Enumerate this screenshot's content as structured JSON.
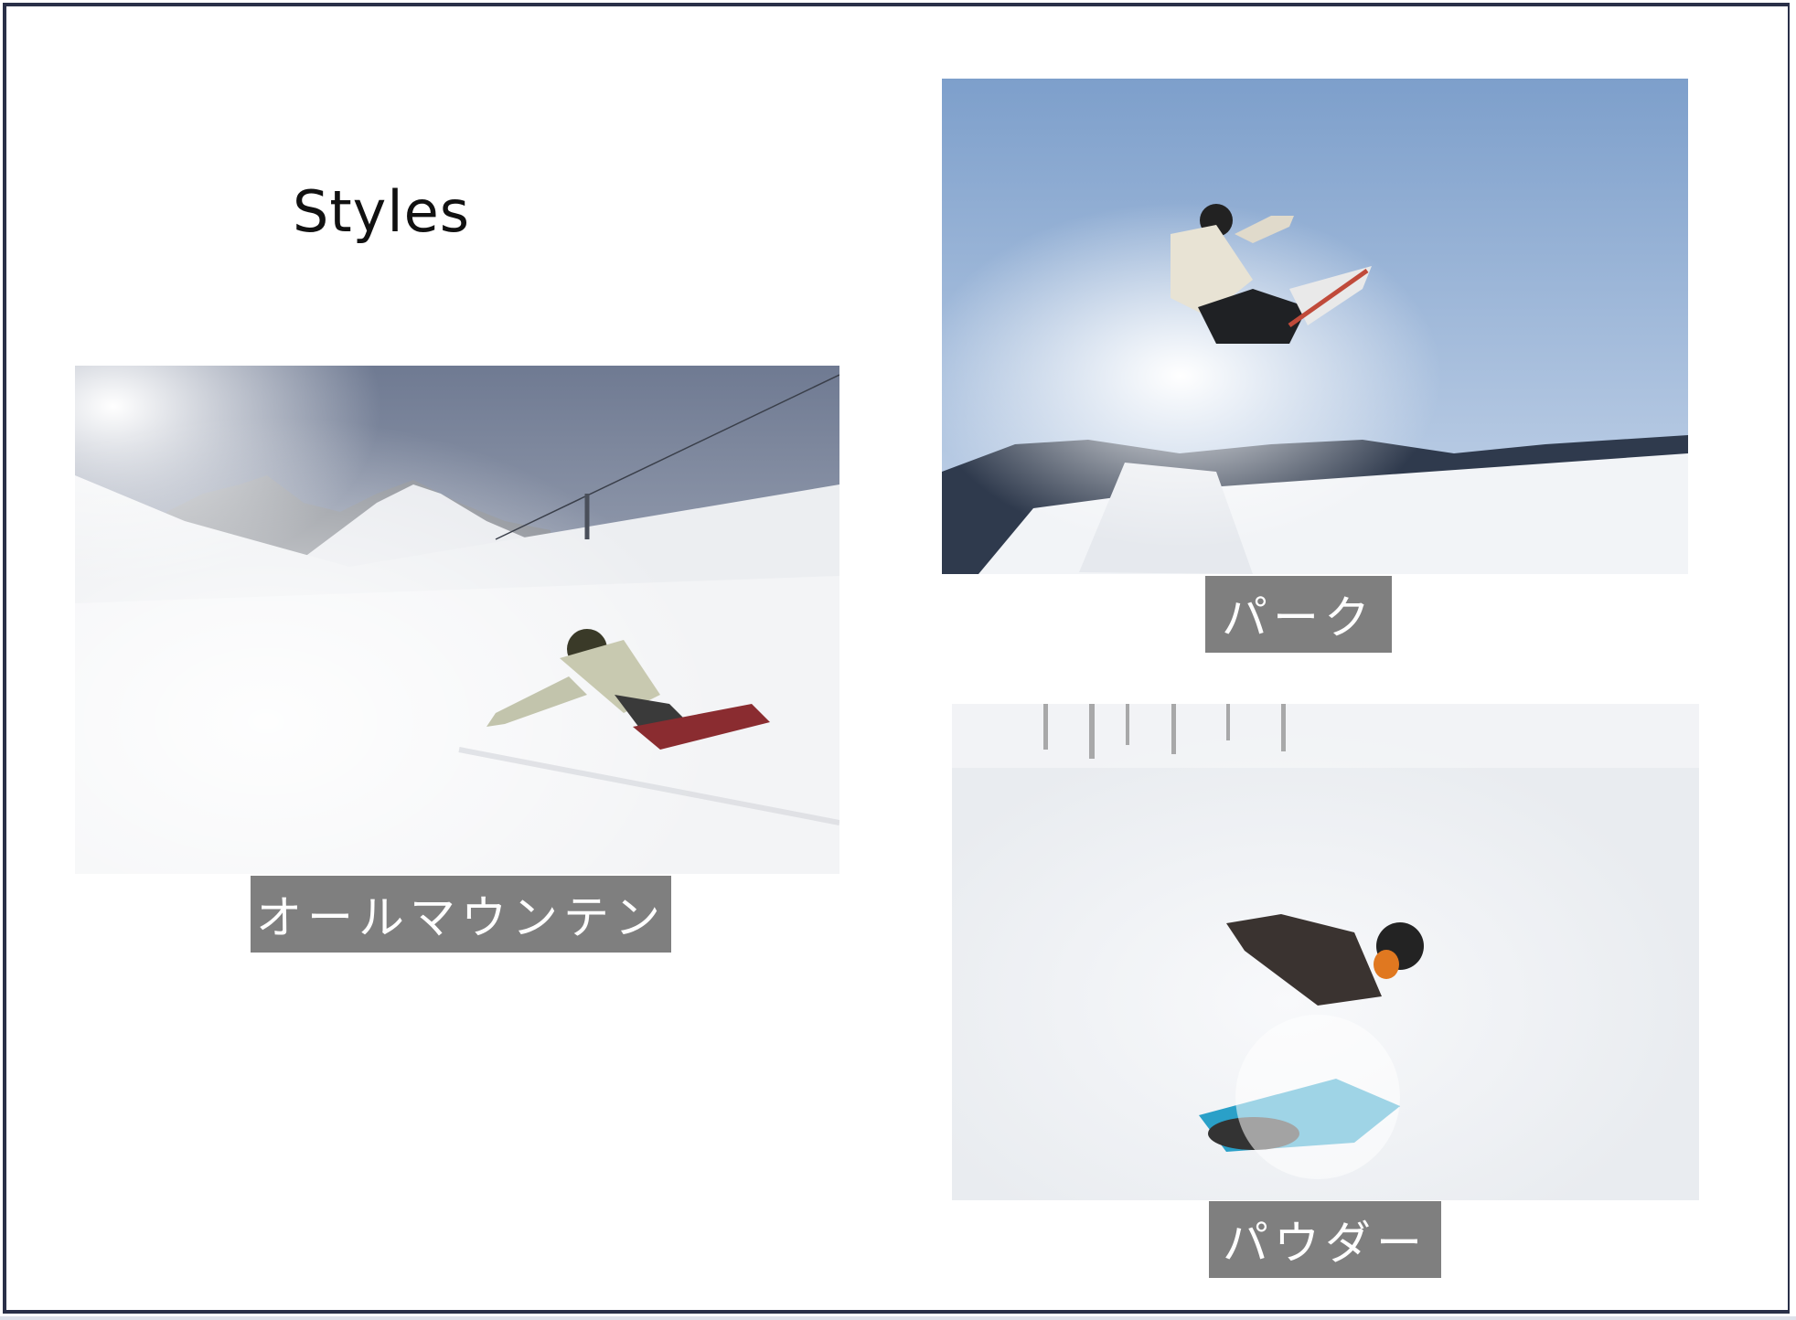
{
  "slide": {
    "title": "Styles"
  },
  "styles": [
    {
      "label": "オールマウンテン",
      "photo_icon": "snowboarder-carving-photo"
    },
    {
      "label": "パーク",
      "photo_icon": "snowboarder-jump-photo"
    },
    {
      "label": "パウダー",
      "photo_icon": "snowboarder-powder-photo"
    }
  ],
  "colors": {
    "frame": "#2a3048",
    "caption_bg": "#7f7f7f",
    "caption_text": "#ffffff"
  }
}
